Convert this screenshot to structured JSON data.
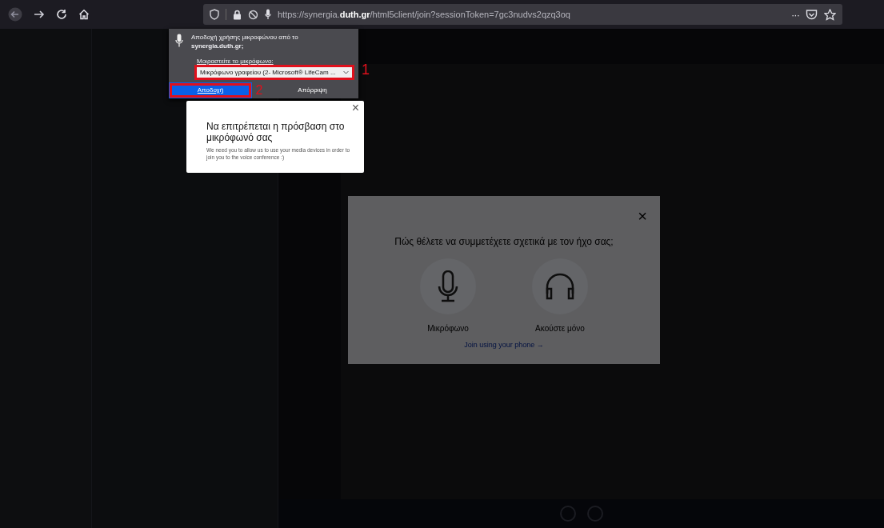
{
  "browser": {
    "url": "https://synergia.**duth.gr**/html5client/join?sessionToken=7gc3nudvs2qzq3oq",
    "menu": "···"
  },
  "permission_popup": {
    "question": "Αποδοχή χρήσης μικροφώνου από το **synergia.duth.gr;**",
    "share_label": "Μοιραστείτε το μικρόφωνο:",
    "device": "Μικρόφωνο γραφείου (2- Microsoft® LifeCam ...",
    "device_marker": "1",
    "buttons": [
      {
        "label": "Αποδοχή",
        "kind": "primary",
        "marker": "2"
      },
      {
        "label": "Απόρριψη",
        "kind": "secondary"
      }
    ]
  },
  "notice": {
    "close": "×",
    "title": "Να επιτρέπεται η πρόσβαση στο μικρόφωνό σας",
    "body": "We need you to allow us to use your media devices in order to join you to the voice conference :)"
  },
  "audio_modal": {
    "close": "×",
    "question": "Πώς θέλετε να συμμετέχετε σχετικά με τον ήχο σας;",
    "options": [
      {
        "label": "Μικρόφωνο",
        "kind": "microphone"
      },
      {
        "label": "Ακούστε μόνο",
        "kind": "listen"
      }
    ],
    "phone_link": "Join using your phone →"
  }
}
